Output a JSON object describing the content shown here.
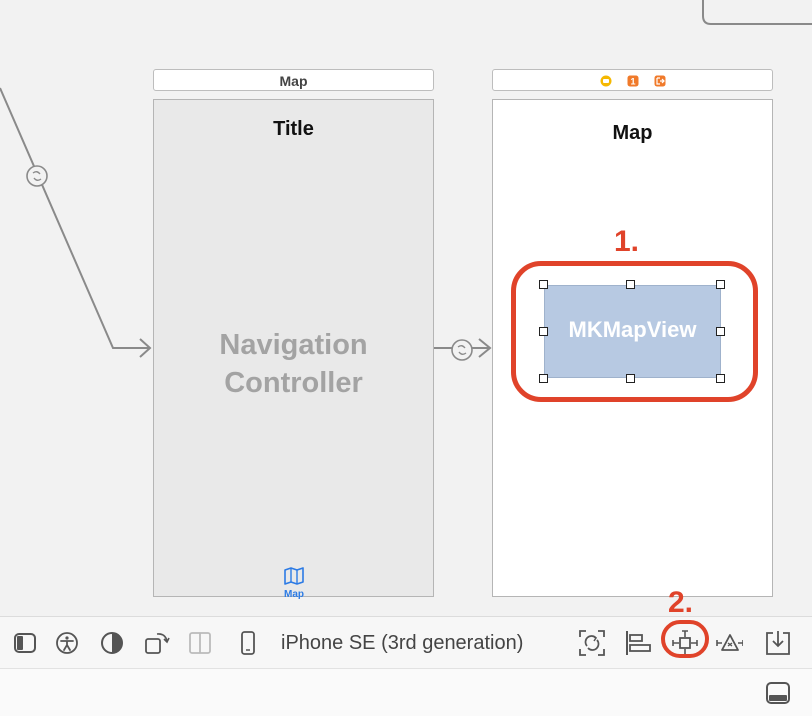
{
  "scenes": {
    "nav_controller": {
      "bar_title": "Map",
      "nav_title": "Title",
      "placeholder_line1": "Navigation",
      "placeholder_line2": "Controller",
      "tab_label": "Map"
    },
    "map_controller": {
      "nav_title": "Map",
      "scene_dock_badge": "1",
      "map_view_label": "MKMapView"
    }
  },
  "annotations": {
    "step1": "1.",
    "step2": "2."
  },
  "toolbar": {
    "device_name": "iPhone SE (3rd generation)",
    "icons": [
      "document-outline-icon",
      "accessibility-icon",
      "appearance-icon",
      "orientation-icon",
      "size-class-icon",
      "device-icon",
      "update-frames-icon",
      "align-icon",
      "add-constraints-icon",
      "resolve-layout-issues-icon",
      "embed-in-icon"
    ]
  },
  "colors": {
    "annotation_red": "#e0432a",
    "mapview_fill": "#b7c9e2",
    "nav_placeholder": "#a3a3a3",
    "tab_blue": "#2c7be5",
    "dock_yellow": "#f5b800",
    "dock_orange": "#f07a2a"
  }
}
